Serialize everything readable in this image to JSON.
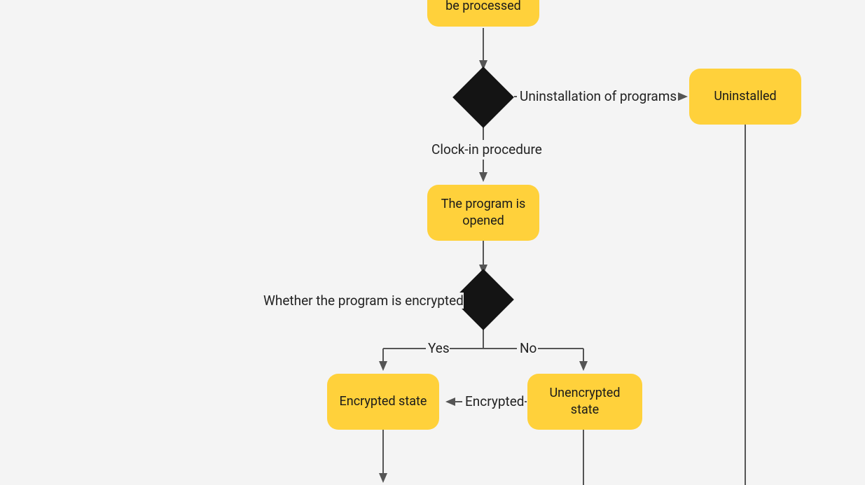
{
  "nodes": {
    "toBeProcessed": "be processed",
    "uninstalled": "Uninstalled",
    "programOpened": "The program is opened",
    "encryptedState": "Encrypted state",
    "unencryptedState": "Unencrypted state"
  },
  "labels": {
    "uninstallPrograms": "Uninstallation of programs",
    "clockIn": "Clock-in procedure",
    "isEncrypted": "Whether the program is encrypted",
    "yes": "Yes",
    "no": "No",
    "encrypted": "Encrypted"
  },
  "chart_data": {
    "type": "flowchart",
    "nodes": [
      {
        "id": "toBeProcessed",
        "kind": "process",
        "label": "be processed"
      },
      {
        "id": "decision1",
        "kind": "decision",
        "label": ""
      },
      {
        "id": "uninstalled",
        "kind": "process",
        "label": "Uninstalled"
      },
      {
        "id": "programOpened",
        "kind": "process",
        "label": "The program is opened"
      },
      {
        "id": "decisionEncrypted",
        "kind": "decision",
        "label": "Whether the program is encrypted"
      },
      {
        "id": "encryptedState",
        "kind": "process",
        "label": "Encrypted state"
      },
      {
        "id": "unencryptedState",
        "kind": "process",
        "label": "Unencrypted state"
      }
    ],
    "edges": [
      {
        "from": "toBeProcessed",
        "to": "decision1",
        "label": ""
      },
      {
        "from": "decision1",
        "to": "uninstalled",
        "label": "Uninstallation of programs",
        "style": "dashed"
      },
      {
        "from": "decision1",
        "to": "programOpened",
        "label": "Clock-in procedure"
      },
      {
        "from": "programOpened",
        "to": "decisionEncrypted",
        "label": ""
      },
      {
        "from": "decisionEncrypted",
        "to": "encryptedState",
        "label": "Yes"
      },
      {
        "from": "decisionEncrypted",
        "to": "unencryptedState",
        "label": "No"
      },
      {
        "from": "unencryptedState",
        "to": "encryptedState",
        "label": "Encrypted"
      },
      {
        "from": "encryptedState",
        "to": "_down1",
        "label": ""
      },
      {
        "from": "unencryptedState",
        "to": "_down2",
        "label": ""
      },
      {
        "from": "uninstalled",
        "to": "_down3",
        "label": ""
      }
    ]
  }
}
